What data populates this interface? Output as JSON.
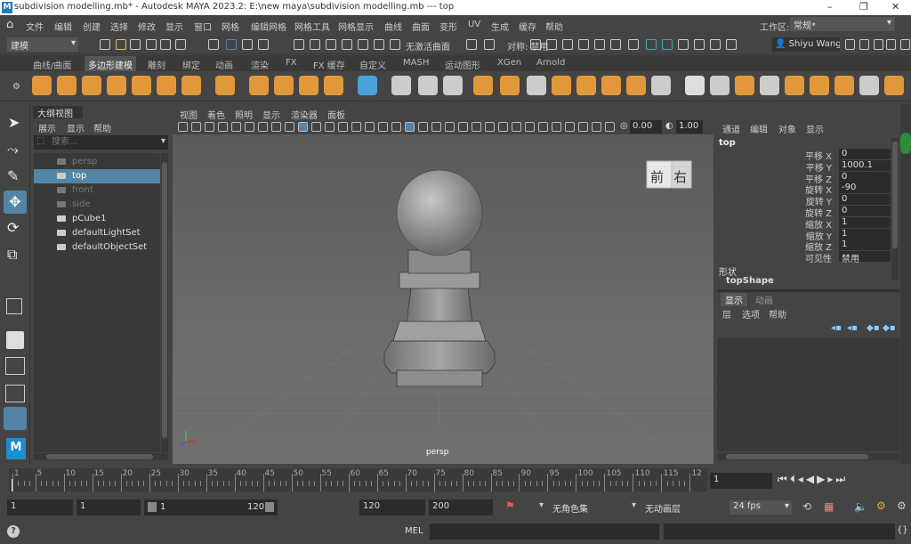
{
  "titlebar": {
    "title": "subdivision modelling.mb* - Autodesk MAYA 2023.2: E:\\new maya\\subdivision modelling.mb   ---   top",
    "minimize": "–",
    "maximize": "❐",
    "close": "✕"
  },
  "menu": [
    "文件",
    "编辑",
    "创建",
    "选择",
    "修改",
    "显示",
    "窗口",
    "网格",
    "编辑网格",
    "网格工具",
    "网格显示",
    "曲线",
    "曲面",
    "变形",
    "UV",
    "生成",
    "缓存",
    "帮助"
  ],
  "workspace": {
    "label": "工作区:",
    "value": "常规*"
  },
  "statusline": {
    "mode": "建模",
    "live": "无激活曲面",
    "symmetry": "对称: 禁用",
    "user": "Shiyu Wang"
  },
  "shelf_tabs": [
    "曲线/曲面",
    "多边形建模",
    "雕刻",
    "绑定",
    "动画",
    "渲染",
    "FX",
    "FX 缓存",
    "自定义",
    "MASH",
    "运动图形",
    "XGen",
    "Arnold"
  ],
  "shelf_active": "多边形建模",
  "outliner": {
    "title": "大纲视图",
    "menu": [
      "展示",
      "显示",
      "帮助"
    ],
    "search_placeholder": "搜索...",
    "items": [
      {
        "label": "persp",
        "dim": true,
        "sel": false,
        "icon": "camera-icon"
      },
      {
        "label": "top",
        "dim": false,
        "sel": true,
        "icon": "camera-icon"
      },
      {
        "label": "front",
        "dim": true,
        "sel": false,
        "icon": "camera-icon"
      },
      {
        "label": "side",
        "dim": true,
        "sel": false,
        "icon": "camera-icon"
      },
      {
        "label": "pCube1",
        "dim": false,
        "sel": false,
        "icon": "mesh-icon"
      },
      {
        "label": "defaultLightSet",
        "dim": false,
        "sel": false,
        "icon": "set-icon"
      },
      {
        "label": "defaultObjectSet",
        "dim": false,
        "sel": false,
        "icon": "set-icon"
      }
    ]
  },
  "viewport": {
    "menu": [
      "视图",
      "着色",
      "照明",
      "显示",
      "渲染器",
      "面板"
    ],
    "field1": "0.00",
    "field2": "1.00",
    "camera_label": "persp",
    "viewcube_front": "前",
    "viewcube_right": "右"
  },
  "channel": {
    "menu": [
      "通道",
      "编辑",
      "对象",
      "显示"
    ],
    "object": "top",
    "attrs": [
      {
        "name": "平移 X",
        "value": "0"
      },
      {
        "name": "平移 Y",
        "value": "1000.1"
      },
      {
        "name": "平移 Z",
        "value": "0"
      },
      {
        "name": "旋转 X",
        "value": "-90"
      },
      {
        "name": "旋转 Y",
        "value": "0"
      },
      {
        "name": "旋转 Z",
        "value": "0"
      },
      {
        "name": "缩放 X",
        "value": "1"
      },
      {
        "name": "缩放 Y",
        "value": "1"
      },
      {
        "name": "缩放 Z",
        "value": "1"
      },
      {
        "name": "可见性",
        "value": "禁用"
      }
    ],
    "shapes_label": "形状",
    "shape": "topShape",
    "layer_tabs": [
      "显示",
      "动画"
    ],
    "layer_menu": [
      "层",
      "选项",
      "帮助"
    ]
  },
  "timeline": {
    "ticks": [
      "1",
      "5",
      "10",
      "15",
      "20",
      "25",
      "30",
      "35",
      "40",
      "45",
      "50",
      "55",
      "60",
      "65",
      "70",
      "75",
      "80",
      "85",
      "90",
      "95",
      "100",
      "105",
      "110",
      "115",
      "12"
    ],
    "current": "1"
  },
  "range": {
    "start": "1",
    "current": "1",
    "slider_start": "1",
    "slider_end": "120",
    "end1": "120",
    "end2": "200",
    "char_set": "无角色集",
    "anim_layer": "无动画层",
    "fps": "24 fps"
  },
  "cmd": {
    "mel": "MEL"
  },
  "colors": {
    "accent": "#5285a6",
    "selected": "#5285a6",
    "bg": "#444444",
    "field": "#2b2b2b"
  }
}
